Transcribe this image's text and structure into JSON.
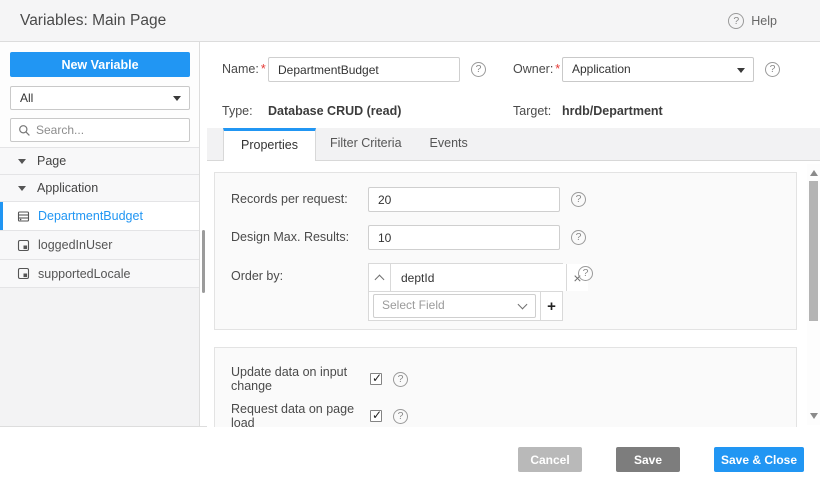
{
  "colors": {
    "accent": "#2196f3",
    "cancel_button": "#b9b9b9",
    "save_button": "#7d7d7d"
  },
  "titlebar": {
    "title": "Variables: Main Page",
    "help_label": "Help"
  },
  "sidebar": {
    "new_variable_label": "New Variable",
    "filter_value": "All",
    "search_placeholder": "Search...",
    "tree": [
      {
        "label": "Page",
        "kind": "group",
        "expanded": true
      },
      {
        "label": "Application",
        "kind": "group",
        "expanded": true
      },
      {
        "label": "DepartmentBudget",
        "kind": "database-variable",
        "selected": true
      },
      {
        "label": "loggedInUser",
        "kind": "static-variable",
        "selected": false
      },
      {
        "label": "supportedLocale",
        "kind": "static-variable",
        "selected": false
      }
    ]
  },
  "detail": {
    "required_mark": "*",
    "name_label": "Name:",
    "name_value": "DepartmentBudget",
    "owner_label": "Owner:",
    "owner_value": "Application",
    "type_label": "Type:",
    "type_value": "Database CRUD (read)",
    "target_label": "Target:",
    "target_value": "hrdb/Department"
  },
  "tabs": [
    {
      "label": "Properties",
      "active": true
    },
    {
      "label": "Filter Criteria",
      "active": false
    },
    {
      "label": "Events",
      "active": false
    }
  ],
  "properties_form": {
    "records_per_request": {
      "label": "Records per request:",
      "value": "20"
    },
    "design_max_results": {
      "label": "Design Max. Results:",
      "value": "10"
    },
    "order_by": {
      "label": "Order by:",
      "field_value": "deptId",
      "select_placeholder": "Select Field"
    },
    "update_data_on_input_change": {
      "label": "Update data on input change",
      "checked": true
    },
    "request_data_on_page_load": {
      "label": "Request data on page load",
      "checked": true
    }
  },
  "footer": {
    "cancel_label": "Cancel",
    "save_label": "Save",
    "save_close_label": "Save & Close"
  }
}
